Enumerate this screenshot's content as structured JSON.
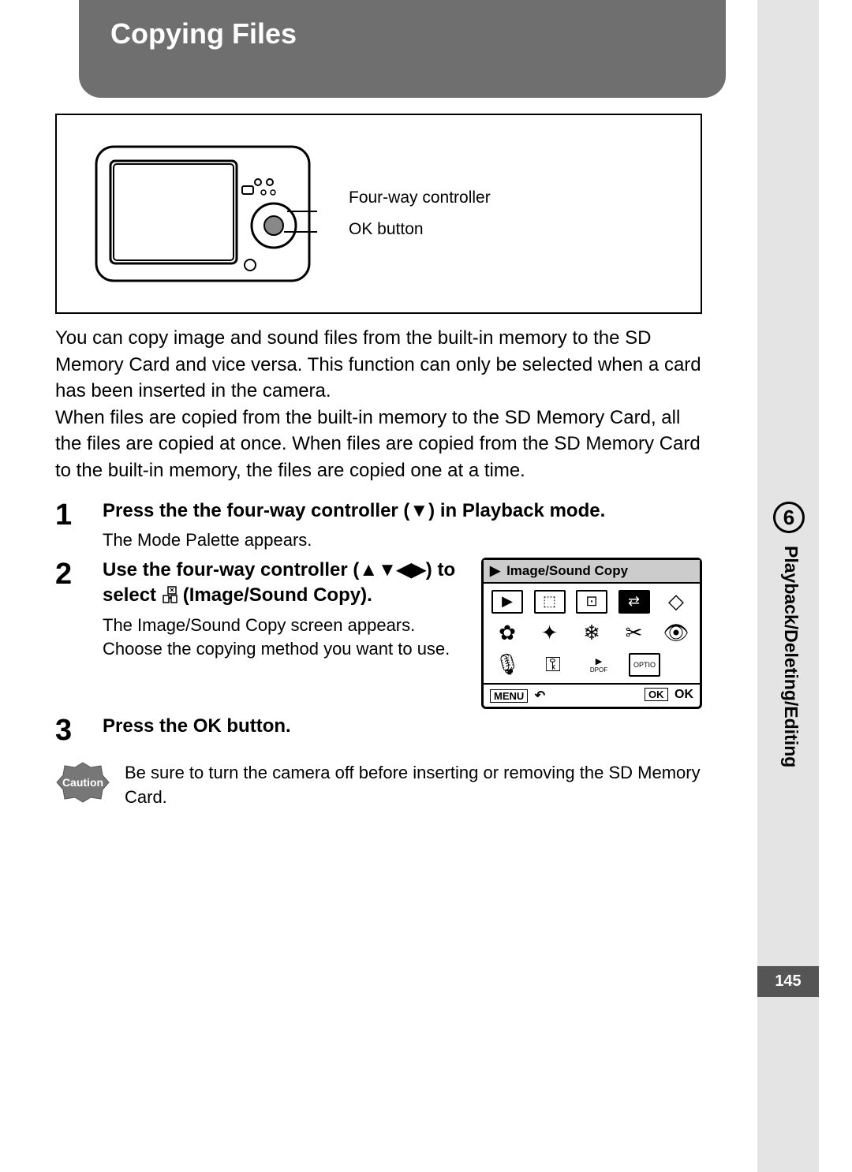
{
  "title": "Copying Files",
  "diagram": {
    "callout1": "Four-way controller",
    "callout2": "OK button"
  },
  "intro": "You can copy image and sound files from the built-in memory to the SD Memory Card and vice versa. This function can only be selected when a card has been inserted in the camera.\nWhen files are copied from the built-in memory to the SD Memory Card, all the files are copied at once. When files are copied from the SD Memory Card to the built-in memory, the files are copied one at a time.",
  "steps": {
    "s1": {
      "num": "1",
      "head": "Press the the four-way controller (▼) in Playback mode.",
      "sub": "The Mode Palette appears."
    },
    "s2": {
      "num": "2",
      "head_pre": "Use the four-way controller (▲▼◀▶) to select ",
      "head_post": " (Image/Sound Copy).",
      "sub": "The Image/Sound Copy screen appears. Choose the copying method you want to use."
    },
    "s3": {
      "num": "3",
      "head": "Press the OK button."
    }
  },
  "palette": {
    "header": "Image/Sound Copy",
    "footer_left": "MENU",
    "footer_back": "↶",
    "footer_ok_box": "OK",
    "footer_ok": "OK"
  },
  "caution": {
    "badge": "Caution",
    "text": "Be sure to turn the camera off before inserting or removing the SD Memory Card."
  },
  "side": {
    "chapter_num": "6",
    "chapter_label": "Playback/Deleting/Editing",
    "page_num": "145"
  }
}
